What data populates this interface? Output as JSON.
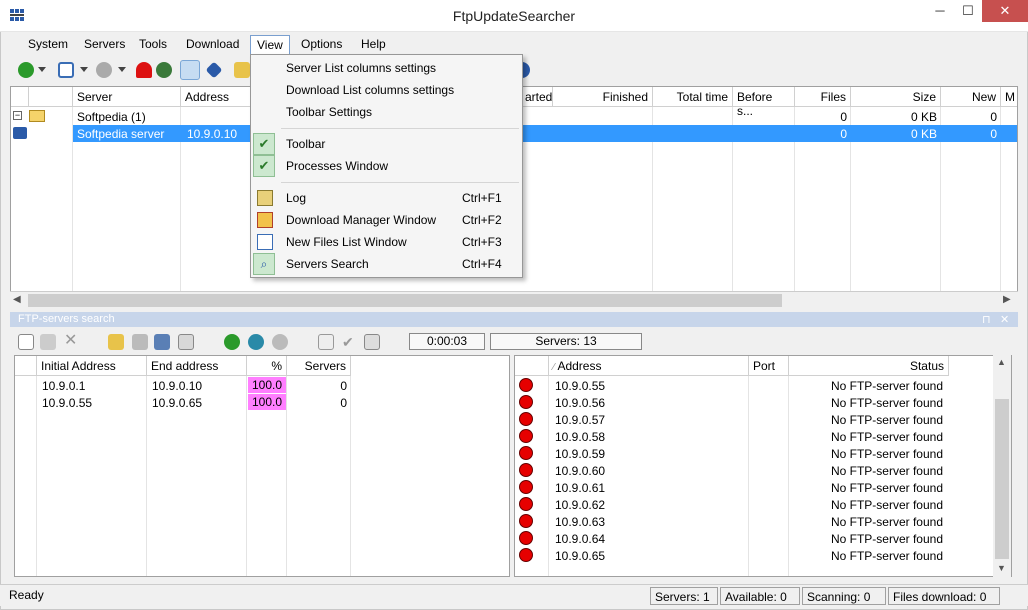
{
  "window": {
    "title": "FtpUpdateSearcher",
    "minimize": "─",
    "maximize": "☐",
    "close": "✕"
  },
  "menu": {
    "items": [
      "System",
      "Servers",
      "Tools",
      "Download",
      "View",
      "Options",
      "Help"
    ]
  },
  "server_list": {
    "columns": [
      "Server",
      "Address",
      "arted",
      "Finished",
      "Total time",
      "Before s...",
      "Files",
      "Size",
      "New",
      "M"
    ],
    "rows": [
      {
        "server": "Softpedia (1)",
        "address": "",
        "files": "0",
        "size": "0 KB",
        "new": "0"
      },
      {
        "server": "Softpedia server",
        "address": "10.9.0.10",
        "files": "0",
        "size": "0 KB",
        "new": "0"
      }
    ]
  },
  "view_menu": {
    "items": [
      {
        "label": "Server List columns settings",
        "shortcut": "",
        "checked": false,
        "icon": ""
      },
      {
        "label": "Download List columns settings",
        "shortcut": "",
        "checked": false,
        "icon": ""
      },
      {
        "label": "Toolbar Settings",
        "shortcut": "",
        "checked": false,
        "icon": ""
      },
      {
        "label": "Toolbar",
        "shortcut": "",
        "checked": true,
        "icon": "check-icon"
      },
      {
        "label": "Processes Window",
        "shortcut": "",
        "checked": true,
        "icon": "check-icon"
      },
      {
        "label": "Log",
        "shortcut": "Ctrl+F1",
        "checked": false,
        "icon": "log-icon"
      },
      {
        "label": "Download Manager Window",
        "shortcut": "Ctrl+F2",
        "checked": false,
        "icon": "download-manager-icon"
      },
      {
        "label": "New Files List Window",
        "shortcut": "Ctrl+F3",
        "checked": false,
        "icon": "new-files-icon"
      },
      {
        "label": "Servers Search",
        "shortcut": "Ctrl+F4",
        "checked": true,
        "icon": "servers-search-icon"
      }
    ]
  },
  "ftp_search": {
    "panel_title": "FTP-servers search",
    "pin": "⊓",
    "close": "✕",
    "timer": "0:00:03",
    "servers_count": "Servers: 13",
    "range_columns": [
      "Initial Address",
      "End address",
      "%",
      "Servers"
    ],
    "ranges": [
      {
        "start": "10.9.0.1",
        "end": "10.9.0.10",
        "percent": "100.0",
        "servers": "0"
      },
      {
        "start": "10.9.0.55",
        "end": "10.9.0.65",
        "percent": "100.0",
        "servers": "0"
      }
    ],
    "result_columns": [
      "Address",
      "Port",
      "Status"
    ],
    "results": [
      {
        "address": "10.9.0.55",
        "port": "",
        "status": "No FTP-server found"
      },
      {
        "address": "10.9.0.56",
        "port": "",
        "status": "No FTP-server found"
      },
      {
        "address": "10.9.0.57",
        "port": "",
        "status": "No FTP-server found"
      },
      {
        "address": "10.9.0.58",
        "port": "",
        "status": "No FTP-server found"
      },
      {
        "address": "10.9.0.59",
        "port": "",
        "status": "No FTP-server found"
      },
      {
        "address": "10.9.0.60",
        "port": "",
        "status": "No FTP-server found"
      },
      {
        "address": "10.9.0.61",
        "port": "",
        "status": "No FTP-server found"
      },
      {
        "address": "10.9.0.62",
        "port": "",
        "status": "No FTP-server found"
      },
      {
        "address": "10.9.0.63",
        "port": "",
        "status": "No FTP-server found"
      },
      {
        "address": "10.9.0.64",
        "port": "",
        "status": "No FTP-server found"
      },
      {
        "address": "10.9.0.65",
        "port": "",
        "status": "No FTP-server found"
      }
    ]
  },
  "status_bar": {
    "ready": "Ready",
    "servers": "Servers: 1",
    "available": "Available: 0",
    "scanning": "Scanning: 0",
    "files_download": "Files download: 0"
  },
  "colors": {
    "selection": "#3399ff",
    "percent_bg": "#ff7fff",
    "status_dot": "#e60000",
    "panel_title": "#c7d5ea",
    "close_button": "#c7504f"
  }
}
